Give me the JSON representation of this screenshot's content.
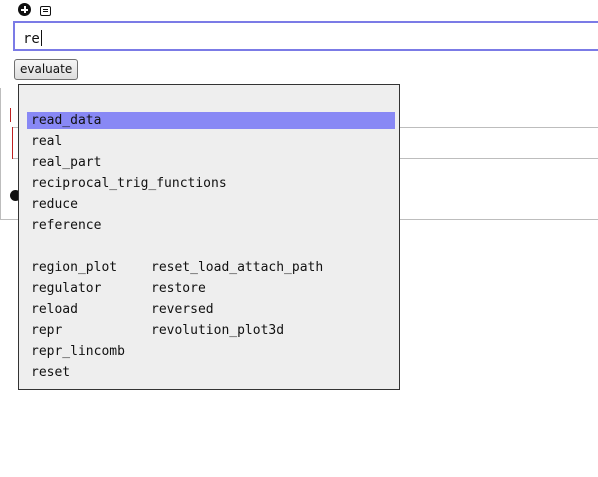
{
  "toolbar": {
    "add_icon": "plus-circle-icon",
    "comment_icon": "comment-icon"
  },
  "cell": {
    "input_text": "re"
  },
  "buttons": {
    "evaluate": "evaluate"
  },
  "completions": {
    "selected": "read_data",
    "group1": [
      "read_data",
      "real",
      "real_part",
      "reciprocal_trig_functions",
      "reduce",
      "reference"
    ],
    "group2_col1": [
      "region_plot",
      "regulator",
      "reload",
      "repr",
      "repr_lincomb",
      "reset"
    ],
    "group2_col2": [
      "reset_load_attach_path",
      "restore",
      "reversed",
      "revolution_plot3d"
    ]
  },
  "colors": {
    "selection": "#8888f5",
    "input_border": "#7b7be6",
    "popup_bg": "#eeeeee"
  }
}
